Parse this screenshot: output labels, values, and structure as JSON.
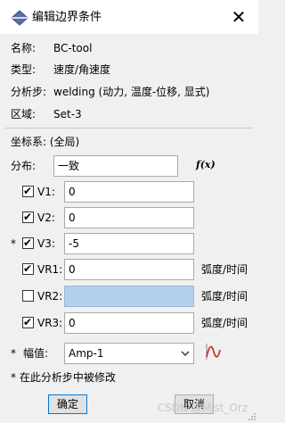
{
  "window": {
    "title": "编辑边界条件",
    "close_glyph": "✕"
  },
  "info": {
    "name": {
      "label": "名称:",
      "value": "BC-tool"
    },
    "type": {
      "label": "类型:",
      "value": "速度/角速度"
    },
    "step": {
      "label": "分析步:",
      "value": "welding (动力, 温度-位移, 显式)"
    },
    "region": {
      "label": "区域:",
      "value": "Set-3"
    }
  },
  "csys": {
    "label": "坐标系:",
    "value": "(全局)"
  },
  "distribution": {
    "label": "分布:",
    "value": "一致",
    "fx_label": "f(x)"
  },
  "fields": [
    {
      "star": "",
      "checked": true,
      "label": "V1:",
      "value": "0",
      "unit": "",
      "enabled": true
    },
    {
      "star": "",
      "checked": true,
      "label": "V2:",
      "value": "0",
      "unit": "",
      "enabled": true
    },
    {
      "star": "*",
      "checked": true,
      "label": "V3:",
      "value": "-5",
      "unit": "",
      "enabled": true
    },
    {
      "star": "",
      "checked": true,
      "label": "VR1:",
      "value": "0",
      "unit": "弧度/时间",
      "enabled": true
    },
    {
      "star": "",
      "checked": false,
      "label": "VR2:",
      "value": "",
      "unit": "弧度/时间",
      "enabled": false
    },
    {
      "star": "",
      "checked": true,
      "label": "VR3:",
      "value": "0",
      "unit": "弧度/时间",
      "enabled": true
    }
  ],
  "amplitude": {
    "star": "*",
    "label": "幅值:",
    "value": "Amp-1"
  },
  "note": "* 在此分析步中被修改",
  "buttons": {
    "ok": "确定",
    "cancel": "取消"
  },
  "watermark": "CSDN @Mist_Orz",
  "colors": {
    "disabled_field": "#b3d0ee",
    "amp_icon": "#c0392b",
    "title_icon": "#5a6fa8"
  }
}
